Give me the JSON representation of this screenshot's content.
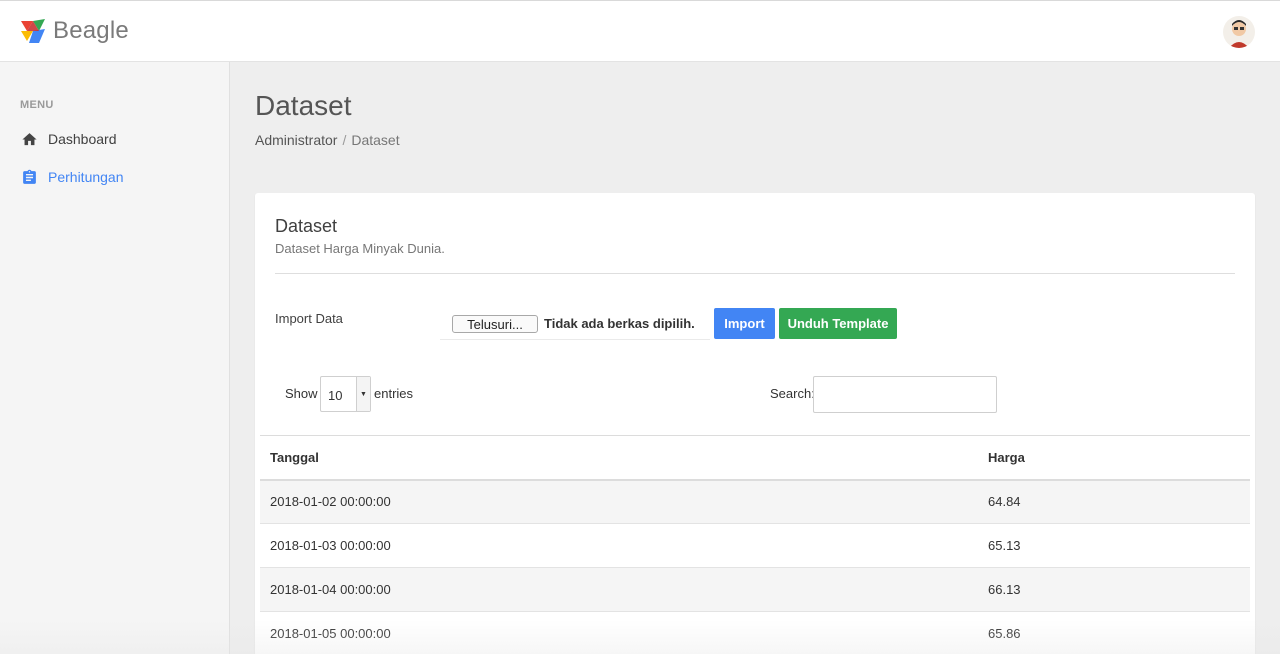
{
  "app": {
    "brand_name": "Beagle",
    "logo_colors": [
      "#ea4335",
      "#fbbc05",
      "#34a853",
      "#4285f4"
    ]
  },
  "sidebar": {
    "heading": "MENU",
    "items": [
      {
        "label": "Dashboard",
        "icon": "home-icon",
        "active": false
      },
      {
        "label": "Perhitungan",
        "icon": "clipboard-icon",
        "active": true
      }
    ]
  },
  "page": {
    "title": "Dataset",
    "breadcrumb": [
      "Administrator",
      "Dataset"
    ]
  },
  "card": {
    "title": "Dataset",
    "subtitle": "Dataset Harga Minyak Dunia."
  },
  "import": {
    "label": "Import Data",
    "browse_label": "Telusuri...",
    "file_status": "Tidak ada berkas dipilih.",
    "import_button": "Import",
    "template_button": "Unduh Template"
  },
  "table_controls": {
    "show_label": "Show",
    "page_length": "10",
    "entries_label": "entries",
    "search_label": "Search:",
    "search_value": ""
  },
  "table": {
    "columns": [
      "Tanggal",
      "Harga"
    ],
    "rows": [
      [
        "2018-01-02 00:00:00",
        "64.84"
      ],
      [
        "2018-01-03 00:00:00",
        "65.13"
      ],
      [
        "2018-01-04 00:00:00",
        "66.13"
      ],
      [
        "2018-01-05 00:00:00",
        "65.86"
      ]
    ]
  },
  "colors": {
    "primary": "#4285f4",
    "success": "#34a853",
    "active_menu": "#4285f4"
  }
}
